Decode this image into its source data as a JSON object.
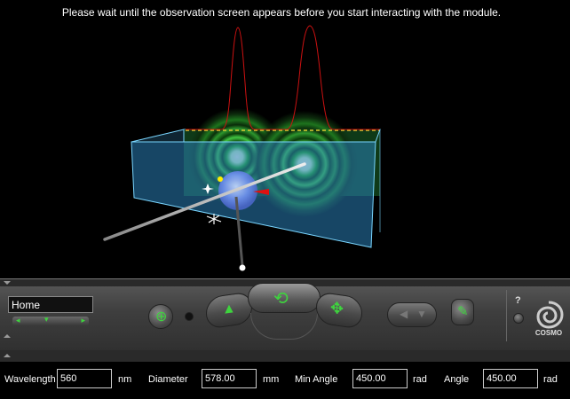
{
  "notice": "Please wait until the observation screen appears before you start interacting with the module.",
  "navbar": {
    "viewpoint": "Home",
    "logo_text": "COSMO",
    "help_glyph": "?"
  },
  "params": {
    "wavelength": {
      "label": "Wavelength",
      "value": "560",
      "unit": "nm"
    },
    "diameter": {
      "label": "Diameter",
      "value": "578.00",
      "unit": "mm"
    },
    "min_angle": {
      "label": "Min Angle",
      "value": "450.00",
      "unit": "rad"
    },
    "angle": {
      "label": "Angle",
      "value": "450.00",
      "unit": "rad"
    }
  },
  "colors": {
    "box_edge": "#7ad6ff",
    "box_fill": "#2a7fb8",
    "curve": "#cc1111",
    "ring_green": "#44ee44",
    "nav_accent": "#3ed43e"
  }
}
